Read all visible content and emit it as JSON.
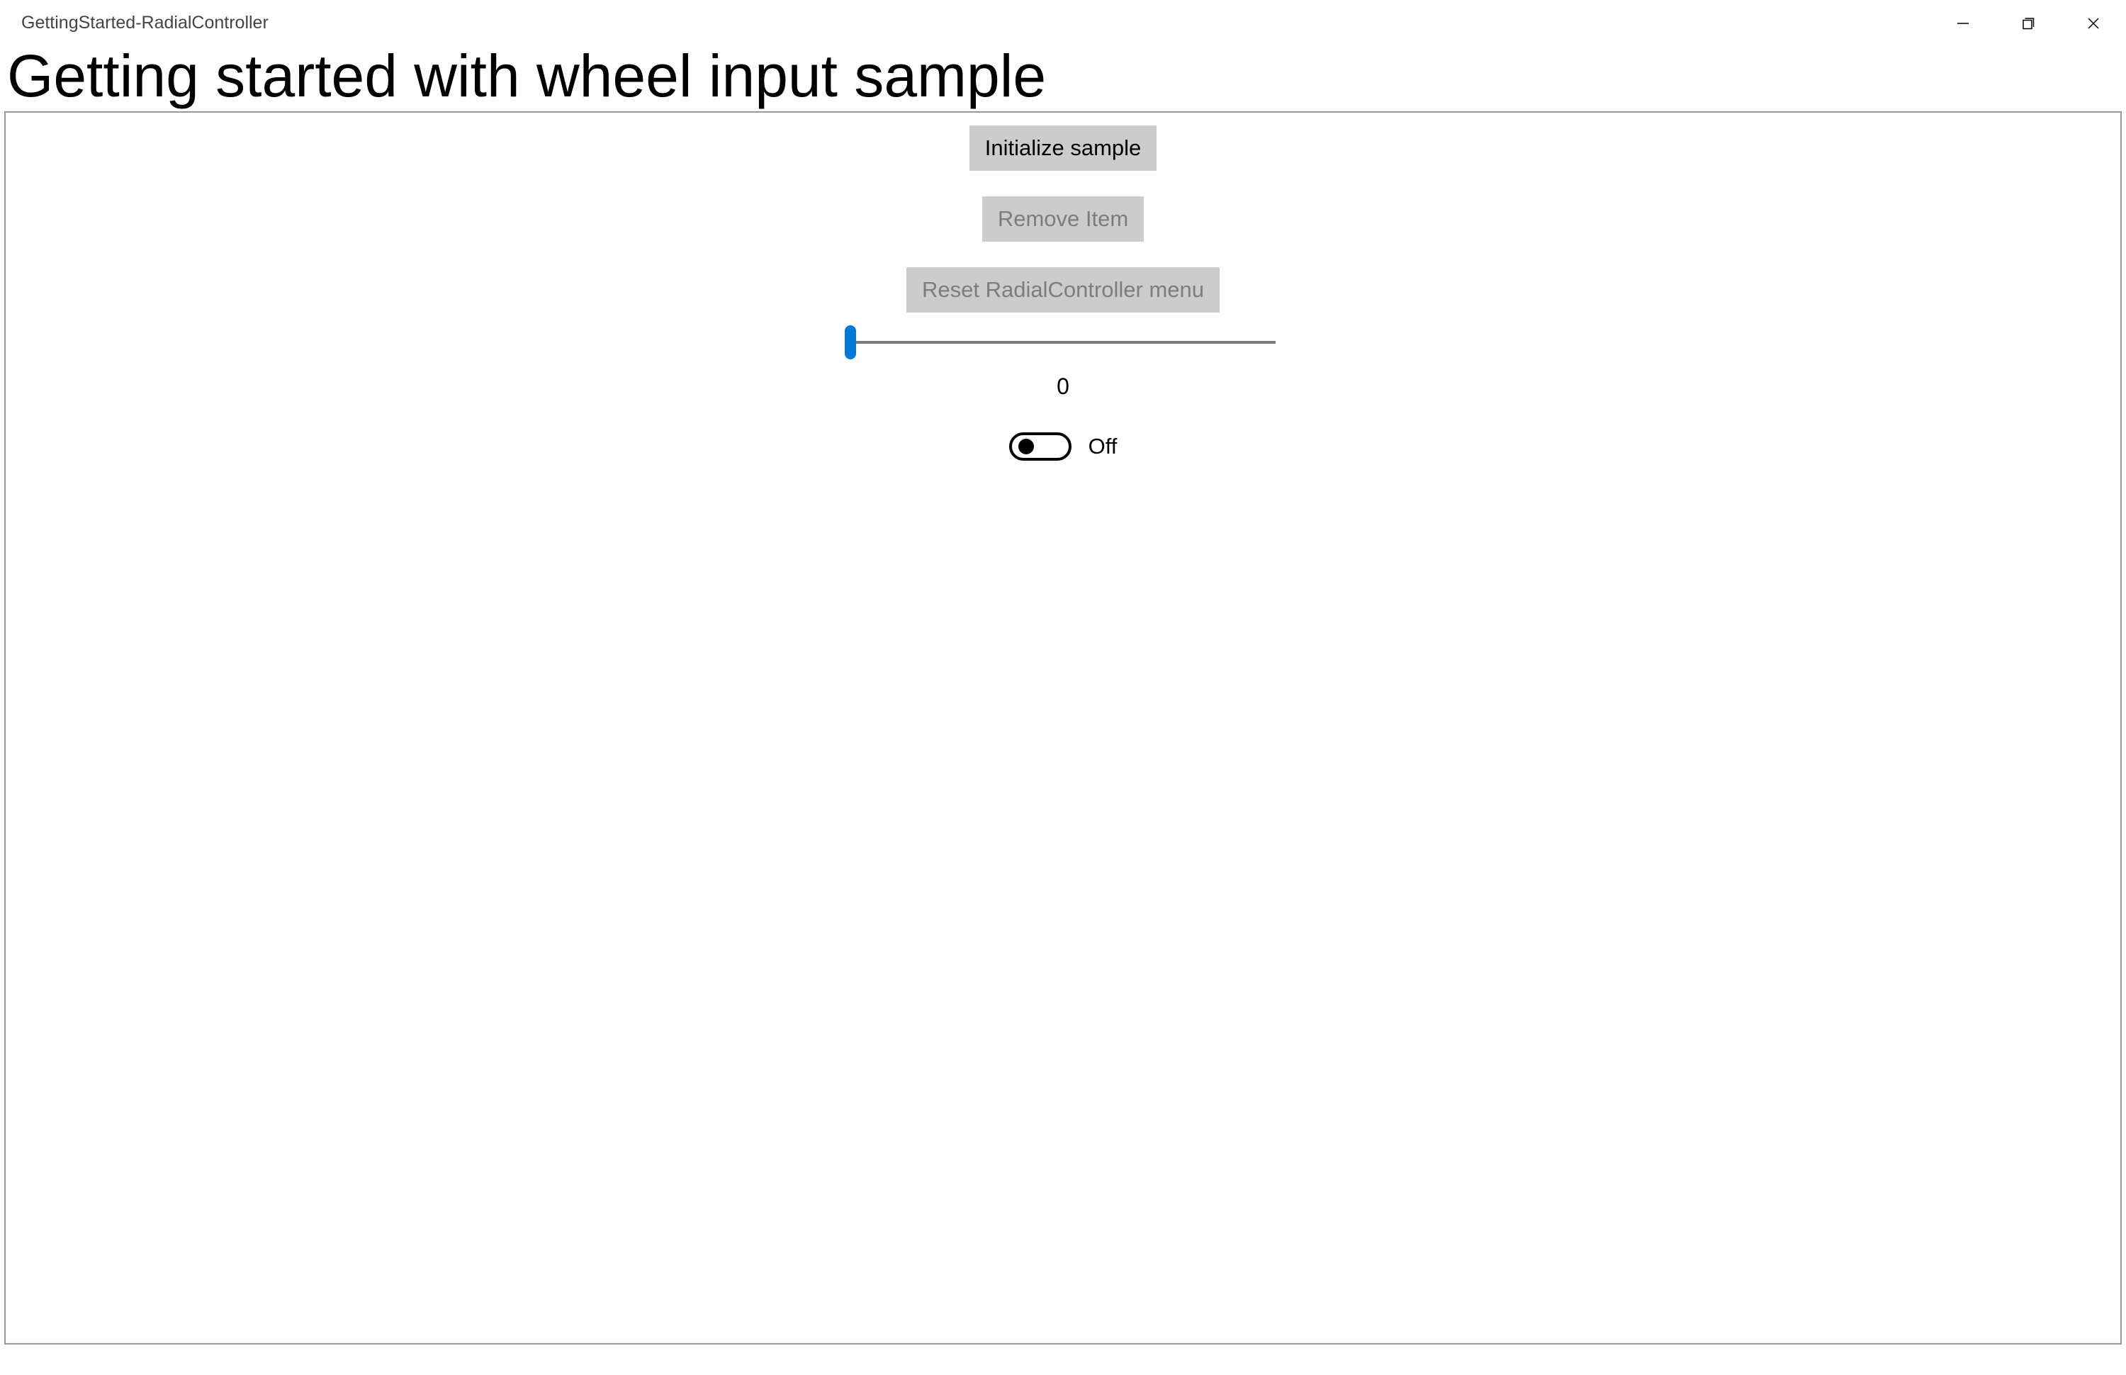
{
  "window": {
    "title": "GettingStarted-RadialController"
  },
  "page": {
    "heading": "Getting started with wheel input sample"
  },
  "controls": {
    "init_button": "Initialize sample",
    "remove_button": "Remove Item",
    "reset_button": "Reset RadialController menu",
    "slider_value": "0",
    "toggle_label": "Off"
  }
}
